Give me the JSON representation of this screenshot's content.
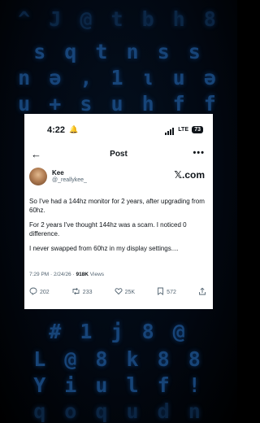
{
  "status": {
    "time": "4:22",
    "network": "LTE",
    "battery": "73"
  },
  "nav": {
    "title": "Post",
    "back_icon": "arrow-left-icon",
    "more_icon": "more-horizontal-icon"
  },
  "author": {
    "name": "Kee",
    "handle": "@_reallykee_"
  },
  "brand": {
    "logo": "𝕏.com"
  },
  "post": {
    "paragraphs": [
      "So I've had a 144hz monitor for 2 years, after upgrading from 60hz.",
      "For 2 years I've thought 144hz was a scam. I noticed 0 difference.",
      "I never swapped from 60hz in my display settings...."
    ],
    "timestamp": "7:29 PM · 2/24/26 · ",
    "views_count": "918K",
    "views_label": " Views"
  },
  "actions": {
    "replies": "202",
    "reposts": "233",
    "likes": "25K",
    "bookmarks": "572"
  },
  "background": {
    "rows": [
      "^ J @ t b h 8",
      "s q t n s s",
      "n ə , 1 ι u ə",
      "u + s u h f f",
      "# 1 j 8 @",
      "L @ 8 k 8 8",
      "Y i u l f !",
      "q o q u d n"
    ]
  },
  "colors": {
    "matrix": "#1b4f8a",
    "card": "#ffffff",
    "text": "#0f1419",
    "muted": "#536471"
  }
}
